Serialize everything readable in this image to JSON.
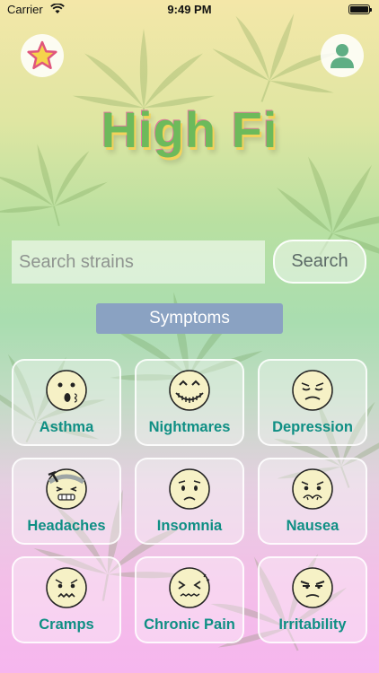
{
  "status_bar": {
    "carrier": "Carrier",
    "time": "9:49 PM"
  },
  "header": {
    "title": "High Fi",
    "favorites_icon": "star-icon",
    "profile_icon": "person-icon"
  },
  "search": {
    "placeholder": "Search strains",
    "value": "",
    "button_label": "Search"
  },
  "symptoms": {
    "heading": "Symptoms",
    "items": [
      {
        "label": "Asthma",
        "icon": "asthma-face-icon"
      },
      {
        "label": "Nightmares",
        "icon": "nightmares-face-icon"
      },
      {
        "label": "Depression",
        "icon": "depression-face-icon"
      },
      {
        "label": "Headaches",
        "icon": "headaches-face-icon"
      },
      {
        "label": "Insomnia",
        "icon": "insomnia-face-icon"
      },
      {
        "label": "Nausea",
        "icon": "nausea-face-icon"
      },
      {
        "label": "Cramps",
        "icon": "cramps-face-icon"
      },
      {
        "label": "Chronic Pain",
        "icon": "chronic-pain-face-icon"
      },
      {
        "label": "Irritability",
        "icon": "irritability-face-icon"
      }
    ]
  },
  "colors": {
    "accent_text": "#0f8f84",
    "title_green": "#6dba5b",
    "header_bar": "#8aa2c2",
    "face_fill": "#f6f1c6"
  }
}
